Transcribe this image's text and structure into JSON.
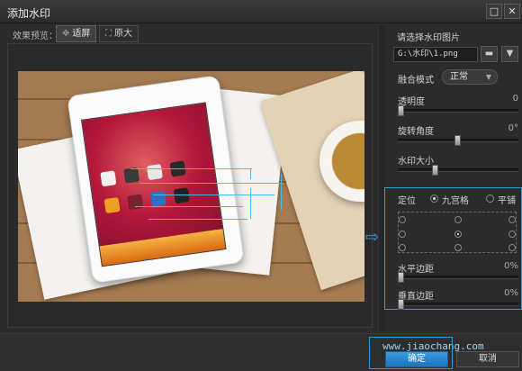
{
  "window": {
    "title": "添加水印",
    "restore_glyph": "□",
    "close_glyph": "✕"
  },
  "preview": {
    "label": "效果预览：",
    "fit_label": "适屏",
    "original_label": "原大",
    "fit_icon": "fit-screen-icon",
    "original_icon": "original-size-icon"
  },
  "right": {
    "choose_label": "请选择水印图片",
    "path_value": "G:\\水印\\1.png",
    "blend_label": "融合模式",
    "blend_value": "正常",
    "opacity_label": "透明度",
    "opacity_value": "0",
    "opacity_level": 0,
    "rotate_label": "旋转角度",
    "rotate_value": "0°",
    "rotate_level": 0.5,
    "size_label": "水印大小",
    "size_level": 0.3,
    "position_label": "定位",
    "radio_grid": "九宫格",
    "radio_tile": "平铺",
    "h_margin_label": "水平边距",
    "h_margin_value": "0%",
    "v_margin_label": "垂直边距",
    "v_margin_value": "0%"
  },
  "footer": {
    "ok_label": "确定",
    "cancel_label": "取消",
    "watermark_text": "www.jiaochang.com"
  },
  "colors": {
    "accent": "#2e9fd6",
    "ok_button": "#2a86cf",
    "background": "#2b2b2b"
  }
}
